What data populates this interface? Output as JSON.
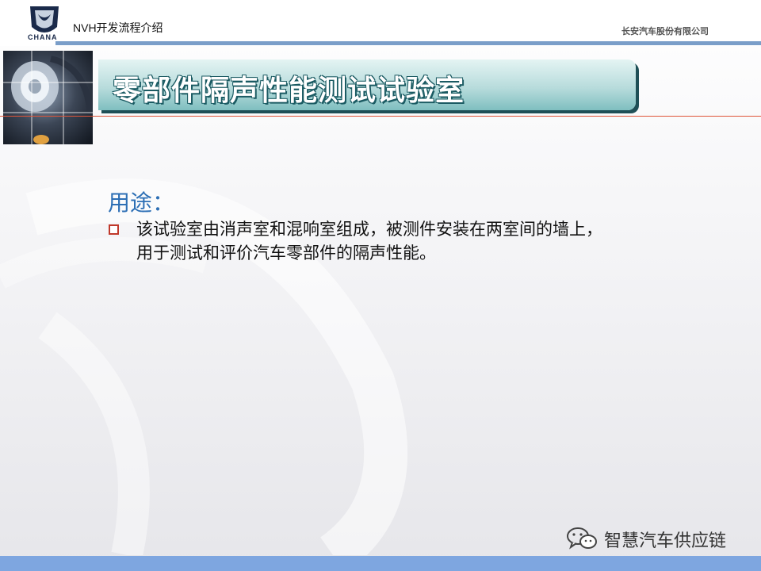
{
  "header": {
    "logo_text": "CHANA",
    "title": "NVH开发流程介绍",
    "company": "长安汽车股份有限公司"
  },
  "slide": {
    "title": "零部件隔声性能测试试验室",
    "section_heading": "用途：",
    "bullets": [
      {
        "text": "该试验室由消声室和混响室组成，被测件安装在两室间的墙上，用于测试和评价汽车零部件的隔声性能。"
      }
    ]
  },
  "footer": {
    "brand": "智慧汽车供应链",
    "icon": "wechat-icon"
  },
  "colors": {
    "accent_blue": "#7ea6e0",
    "heading_blue": "#2d6fb5",
    "banner_teal": "#7fbfc0",
    "bullet_red": "#c0392b"
  }
}
